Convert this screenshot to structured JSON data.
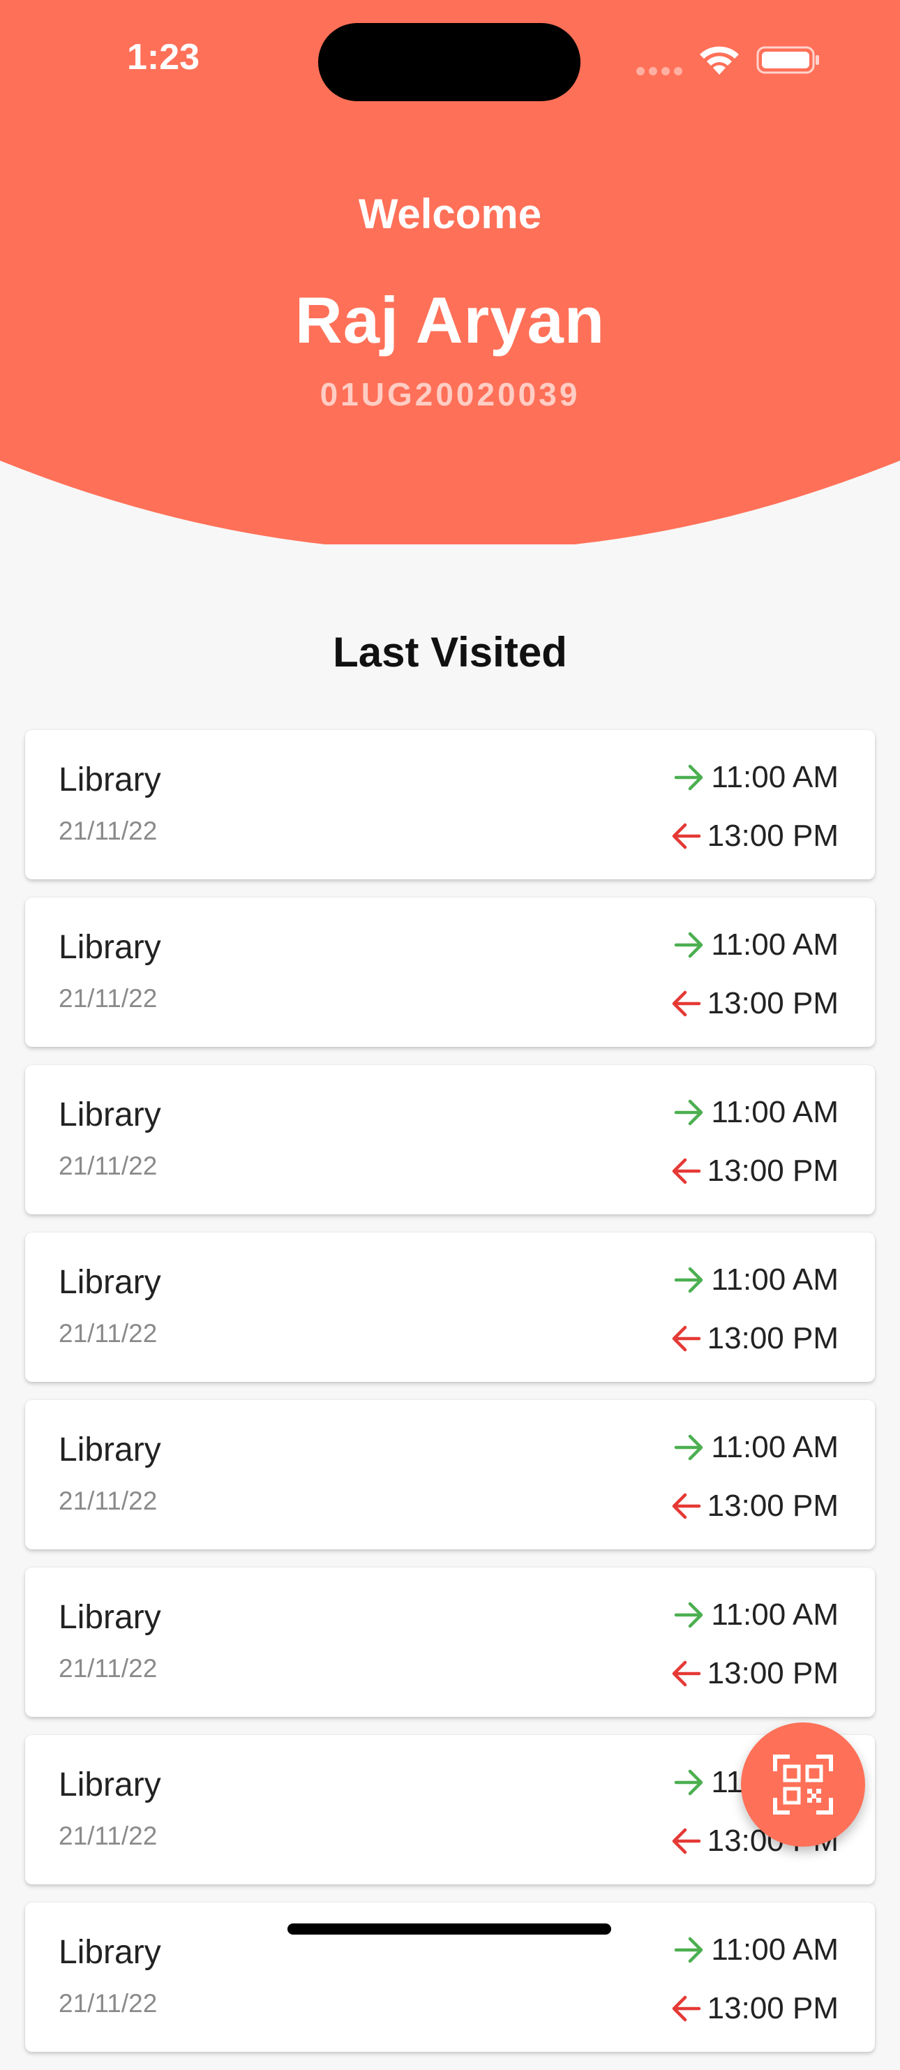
{
  "status_bar": {
    "time": "1:23"
  },
  "header": {
    "welcome": "Welcome",
    "name": "Raj Aryan",
    "id": "01UG20020039"
  },
  "section_title": "Last Visited",
  "visits": [
    {
      "place": "Library",
      "date": "21/11/22",
      "in_time": "11:00 AM",
      "out_time": "13:00 PM"
    },
    {
      "place": "Library",
      "date": "21/11/22",
      "in_time": "11:00 AM",
      "out_time": "13:00 PM"
    },
    {
      "place": "Library",
      "date": "21/11/22",
      "in_time": "11:00 AM",
      "out_time": "13:00 PM"
    },
    {
      "place": "Library",
      "date": "21/11/22",
      "in_time": "11:00 AM",
      "out_time": "13:00 PM"
    },
    {
      "place": "Library",
      "date": "21/11/22",
      "in_time": "11:00 AM",
      "out_time": "13:00 PM"
    },
    {
      "place": "Library",
      "date": "21/11/22",
      "in_time": "11:00 AM",
      "out_time": "13:00 PM"
    },
    {
      "place": "Library",
      "date": "21/11/22",
      "in_time": "11:00 AM",
      "out_time": "13:00 PM"
    },
    {
      "place": "Library",
      "date": "21/11/22",
      "in_time": "11:00 AM",
      "out_time": "13:00 PM"
    }
  ],
  "icons": {
    "in_arrow": "arrow-right-icon",
    "out_arrow": "arrow-left-icon",
    "fab": "qr-code-scan-icon"
  },
  "colors": {
    "primary": "#ff7058",
    "in_arrow": "#4caf50",
    "out_arrow": "#e53935",
    "background": "#f7f7f7"
  }
}
